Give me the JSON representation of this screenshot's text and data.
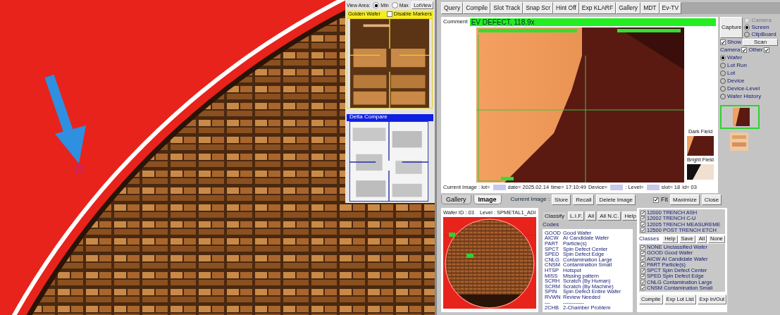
{
  "view_panel": {
    "view_area_label": "View Area:",
    "view_area_options": [
      {
        "label": "Min",
        "selected": true
      },
      {
        "label": "Max",
        "selected": false
      }
    ],
    "lotview_button": "LotView",
    "golden_wafer": {
      "title": "Golden Wafer",
      "disable_markers": {
        "label": "Disable Markers",
        "checked": false
      }
    },
    "delta_compare": {
      "title": "Delta Compare"
    }
  },
  "toolbar": [
    "Query",
    "Compile",
    "Slot Track",
    "Snap Scr",
    "Hint Off",
    "Exp KLARF",
    "Gallery",
    "MDT",
    "Ev-TV"
  ],
  "comment": {
    "label": "Comment",
    "value": "EV DEFECT, 118.9x"
  },
  "image_panel": {
    "dark_field": "Dark Field",
    "bright_field": "Bright Field"
  },
  "status_line": [
    {
      "text": "Current Image : lot=",
      "redacted": true
    },
    {
      "text": "date= 2025.02.14",
      "redacted": false
    },
    {
      "text": "time= 17:10:49",
      "redacted": false
    },
    {
      "text": "Device=",
      "redacted": true
    },
    {
      "text": ": Level=",
      "redacted": true
    },
    {
      "text": "slot= 18",
      "redacted": false
    },
    {
      "text": "id= 03",
      "redacted": false
    }
  ],
  "capture": {
    "button": "Capture",
    "targets": [
      {
        "label": "Camera",
        "selected": false,
        "disabled": true
      },
      {
        "label": "Screen",
        "selected": true,
        "disabled": false
      },
      {
        "label": "ClipBoard",
        "selected": false,
        "disabled": false
      }
    ],
    "show": {
      "label": "Show",
      "checked": true
    },
    "scan_button": "Scan",
    "camera": {
      "label": "Camera",
      "checked": true
    },
    "other": {
      "label": "Other",
      "checked": true
    },
    "scope": [
      {
        "label": "Wafer",
        "selected": true
      },
      {
        "label": "Lot Run",
        "selected": false
      },
      {
        "label": "Lot",
        "selected": false
      },
      {
        "label": "Device",
        "selected": false
      },
      {
        "label": "Device-Level",
        "selected": false
      },
      {
        "label": "Wafer History",
        "selected": false
      }
    ]
  },
  "tabs": [
    {
      "label": "Gallery",
      "selected": false
    },
    {
      "label": "Image",
      "selected": true
    }
  ],
  "image_actions": {
    "label": "Current Image :",
    "buttons": [
      "Store",
      "Recall",
      "Delete Image"
    ],
    "fit": {
      "label": "Fit",
      "checked": true
    },
    "window_buttons": [
      "Maximize",
      "Close"
    ]
  },
  "wafer_map": {
    "wafer_id": "Wafer ID : 03",
    "level": "Level : SPMETAL1_ADI"
  },
  "classify": {
    "buttons": [
      {
        "label": "Classify",
        "selected": true
      },
      {
        "label": "L.I.F.",
        "selected": false
      },
      {
        "label": "All",
        "selected": false
      },
      {
        "label": "All N.C.",
        "selected": false
      },
      {
        "label": "Help",
        "selected": false
      }
    ],
    "codes_label": "Codes",
    "codes": [
      {
        "code": "GOOD",
        "description": "Good Wafer"
      },
      {
        "code": "AICW",
        "description": "AI Candidate Wafer"
      },
      {
        "code": "PART",
        "description": "Particle(s)"
      },
      {
        "code": "SPCT",
        "description": "Spin Defect Center"
      },
      {
        "code": "SPED",
        "description": "Spin Defect Edge"
      },
      {
        "code": "CNLG",
        "description": "Contamination Large"
      },
      {
        "code": "CNSM",
        "description": "Contamination Small"
      },
      {
        "code": "HTSP",
        "description": "Hotspot"
      },
      {
        "code": "MISS",
        "description": "Missing pattern"
      },
      {
        "code": "SCRH",
        "description": "Scratch (By Human)"
      },
      {
        "code": "SCRM",
        "description": "Scratch (By Machine)"
      },
      {
        "code": "SPIN",
        "description": "Spin Defect Entire Wafer"
      },
      {
        "code": "RVWN",
        "description": "Review Needed"
      },
      {
        "code": "---",
        "description": "------------"
      },
      {
        "code": "2CHB",
        "description": "2-Chamber Problem"
      }
    ]
  },
  "levels": [
    {
      "label": "12000 TRENCH ASH",
      "checked": true
    },
    {
      "label": "12002 TRENCH C-U",
      "checked": true
    },
    {
      "label": "12005 TRENCH MEASUREME",
      "checked": true
    },
    {
      "label": "12500 POST TRENCH ETCH",
      "checked": true
    }
  ],
  "classes_label": "Classes",
  "classes_buttons": [
    "Help",
    "Save",
    "All",
    "None"
  ],
  "classes": [
    {
      "label": "NONE Unclassified Wafer",
      "checked": true
    },
    {
      "label": "GOOD Good Wafer",
      "checked": true
    },
    {
      "label": "AICW AI Candidate Wafer",
      "checked": true
    },
    {
      "label": "PART Particle(s)",
      "checked": true
    },
    {
      "label": "SPCT Spin Defect Center",
      "checked": true
    },
    {
      "label": "SPED Spin Defect Edge",
      "checked": true
    },
    {
      "label": "CNLG Contamination Large",
      "checked": true
    },
    {
      "label": "CNSM Contamination Small",
      "checked": true
    }
  ],
  "bottom_buttons": [
    "Compile",
    "Exp Lot List",
    "Exp In/Out"
  ]
}
